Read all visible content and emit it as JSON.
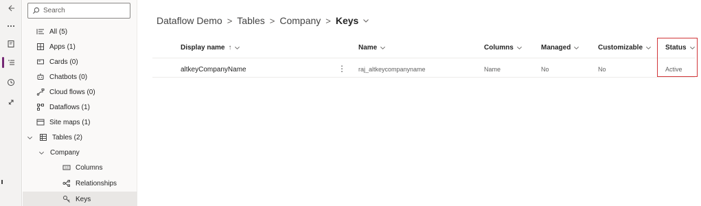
{
  "rail": {
    "icons": [
      "back-arrow-icon",
      "more-icon",
      "book-icon",
      "tree-view-icon",
      "history-icon",
      "rocket-icon"
    ]
  },
  "tree": {
    "search_placeholder": "Search",
    "items": [
      {
        "label": "All (5)",
        "icon": "list-icon"
      },
      {
        "label": "Apps (1)",
        "icon": "apps-icon"
      },
      {
        "label": "Cards (0)",
        "icon": "card-icon"
      },
      {
        "label": "Chatbots (0)",
        "icon": "chatbot-icon"
      },
      {
        "label": "Cloud flows (0)",
        "icon": "flow-icon"
      },
      {
        "label": "Dataflows (1)",
        "icon": "dataflow-icon"
      },
      {
        "label": "Site maps (1)",
        "icon": "sitemap-icon"
      },
      {
        "label": "Tables (2)",
        "icon": "table-icon"
      },
      {
        "label": "Company",
        "icon": "chevron-down-icon"
      },
      {
        "label": "Columns",
        "icon": "columns-icon"
      },
      {
        "label": "Relationships",
        "icon": "relationships-icon"
      },
      {
        "label": "Keys",
        "icon": "key-icon"
      }
    ]
  },
  "breadcrumb": {
    "items": [
      "Dataflow Demo",
      "Tables",
      "Company"
    ],
    "current": "Keys",
    "separator": ">"
  },
  "table": {
    "columns": [
      "Display name",
      "Name",
      "Columns",
      "Managed",
      "Customizable",
      "Status"
    ],
    "sort_indicator": "↑",
    "rows": [
      {
        "display_name": "altkeyCompanyName",
        "more": "⋮",
        "name": "raj_altkeycompanyname",
        "columns": "Name",
        "managed": "No",
        "customizable": "No",
        "status": "Active"
      }
    ]
  },
  "colors": {
    "accent": "#742774",
    "highlight_border": "#d13438"
  }
}
